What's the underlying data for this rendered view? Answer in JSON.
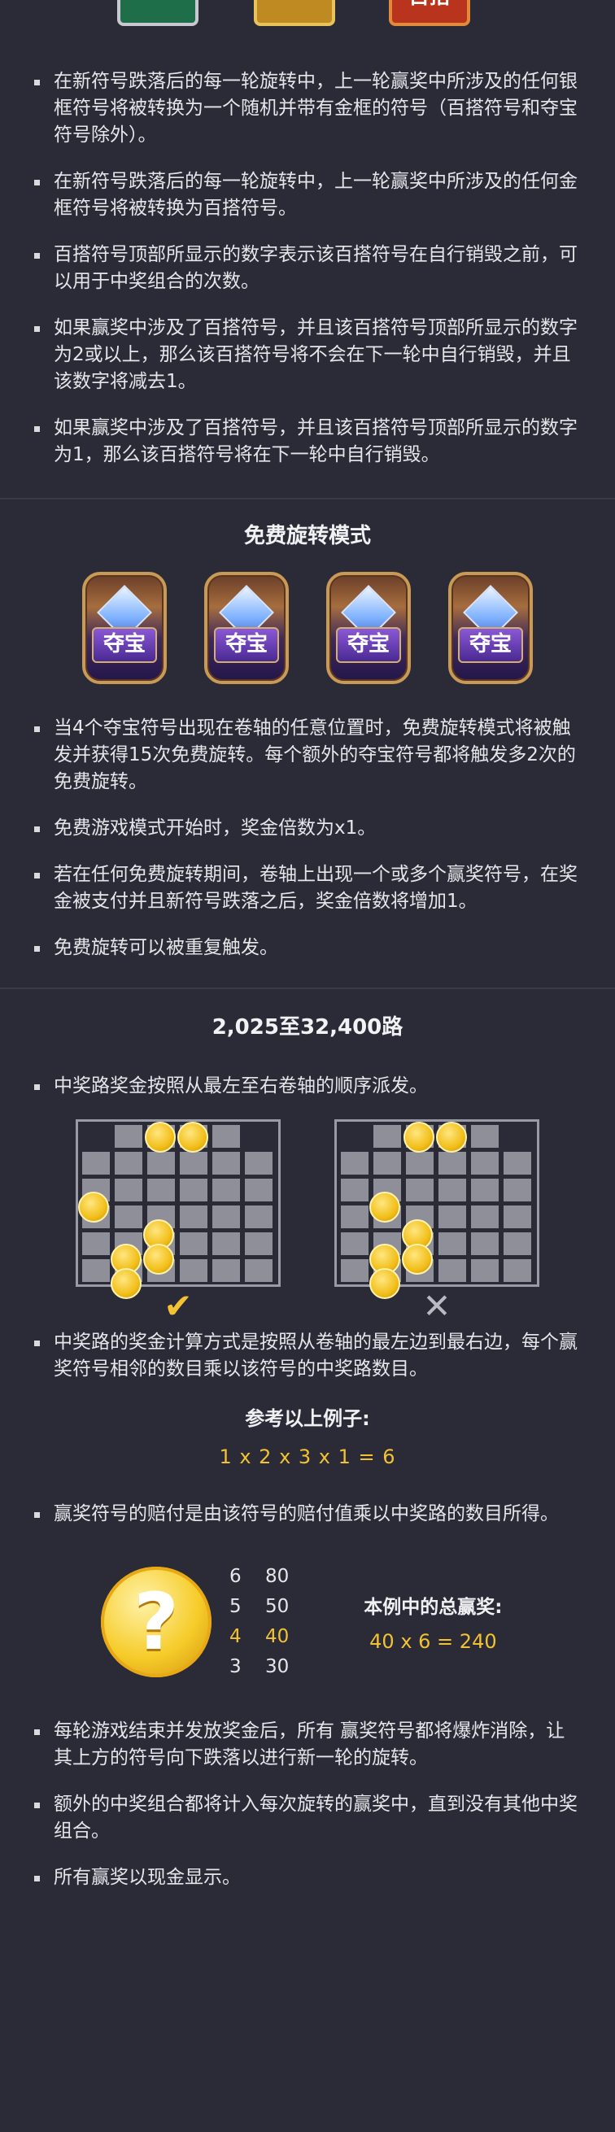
{
  "top_symbols": {
    "colors": [
      "#1f6e4a",
      "#c08a23",
      "#b8341c"
    ],
    "third_label": "百搭"
  },
  "section1": {
    "bullets": [
      "在新符号跌落后的每一轮旋转中，上一轮赢奖中所涉及的任何银框符号将被转换为一个随机并带有金框的符号（百搭符号和夺宝符号除外）。",
      "在新符号跌落后的每一轮旋转中，上一轮赢奖中所涉及的任何金框符号将被转换为百搭符号。",
      "百搭符号顶部所显示的数字表示该百搭符号在自行销毁之前，可以用于中奖组合的次数。",
      "如果赢奖中涉及了百搭符号，并且该百搭符号顶部所显示的数字为2或以上，那么该百搭符号将不会在下一轮中自行销毁，并且该数字将减去1。",
      "如果赢奖中涉及了百搭符号，并且该百搭符号顶部所显示的数字为1，那么该百搭符号将在下一轮中自行销毁。"
    ]
  },
  "free_spins": {
    "title": "免费旋转模式",
    "chest_label": "夺宝",
    "chest_count_icons": [
      "scatter-icon-1",
      "scatter-icon-2",
      "scatter-icon-3",
      "scatter-icon-4"
    ],
    "bullets": [
      "当4个夺宝符号出现在卷轴的任意位置时，免费旋转模式将被触发并获得15次免费旋转。每个额外的夺宝符号都将触发多2次的免费旋转。",
      "免费游戏模式开始时，奖金倍数为x1。",
      "若在任何免费旋转期间，卷轴上出现一个或多个赢奖符号，在奖金被支付并且新符号跌落之后，奖金倍数将增加1。",
      "免费旋转可以被重复触发。"
    ]
  },
  "ways": {
    "title": "2,025至32,400路",
    "bullet1": "中奖路奖金按照从最左至右卷轴的顺序派发。",
    "check_symbol": "✔",
    "cross_symbol": "✕",
    "bullet2": "中奖路的奖金计算方式是按照从卷轴的最左边到最右边，每个赢奖符号相邻的数目乘以该符号的中奖路数目。",
    "example_label": "参考以上例子:",
    "example_eq": "1 x 2 x 3 x 1 = 6",
    "bullet3": "赢奖符号的赔付是由该符号的赔付值乘以中奖路的数目所得。",
    "coin_glyph": "?",
    "paytable": [
      {
        "count": "6",
        "value": "80",
        "highlight": false
      },
      {
        "count": "5",
        "value": "50",
        "highlight": false
      },
      {
        "count": "4",
        "value": "40",
        "highlight": true
      },
      {
        "count": "3",
        "value": "30",
        "highlight": false
      }
    ],
    "total_label": "本例中的总赢奖:",
    "total_eq": "40 x 6 = 240",
    "bullets_end": [
      "每轮游戏结束并发放奖金后，所有 赢奖符号都将爆炸消除，让其上方的符号向下跌落以进行新一轮的旋转。",
      "额外的中奖组合都将计入每次旋转的赢奖中，直到没有其他中奖组合。",
      "所有赢奖以现金显示。"
    ]
  }
}
